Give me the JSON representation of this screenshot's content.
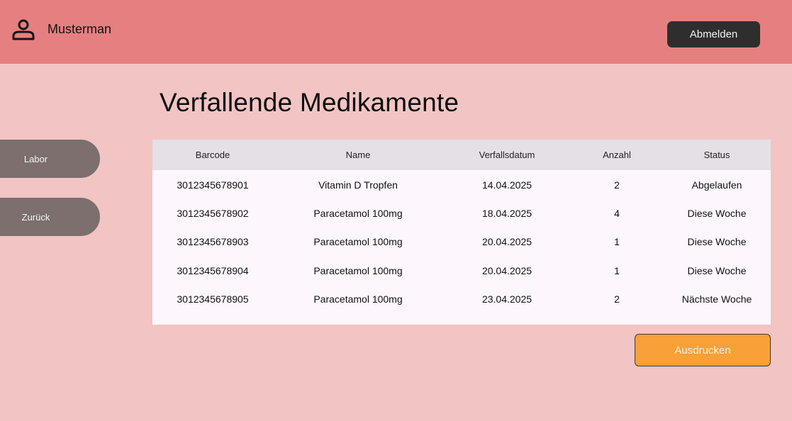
{
  "header": {
    "user_icon": "user-icon",
    "user_name": "Musterman",
    "logout_label": "Abmelden"
  },
  "sidebar": {
    "items": [
      {
        "label": "Labor"
      },
      {
        "label": "Zurück"
      }
    ]
  },
  "main": {
    "title": "Verfallende Medikamente",
    "table": {
      "columns": [
        "Barcode",
        "Name",
        "Verfallsdatum",
        "Anzahl",
        "Status"
      ],
      "rows": [
        [
          "3012345678901",
          "Vitamin D Tropfen",
          "14.04.2025",
          "2",
          "Abgelaufen"
        ],
        [
          "3012345678902",
          "Paracetamol 100mg",
          "18.04.2025",
          "4",
          "Diese Woche"
        ],
        [
          "3012345678903",
          "Paracetamol 100mg",
          "20.04.2025",
          "1",
          "Diese Woche"
        ],
        [
          "3012345678904",
          "Paracetamol 100mg",
          "20.04.2025",
          "1",
          "Diese Woche"
        ],
        [
          "3012345678905",
          "Paracetamol 100mg",
          "23.04.2025",
          "2",
          "Nächste Woche"
        ]
      ]
    },
    "print_label": "Ausdrucken"
  },
  "colors": {
    "header_bg": "#e67f80",
    "page_bg": "#f2c4c4",
    "sidebar_button": "#7c6f6e",
    "logout_button": "#2e2e2e",
    "print_button": "#f9a036",
    "table_bg": "#fdf6fd",
    "table_header_bg": "#e5dfe6"
  }
}
